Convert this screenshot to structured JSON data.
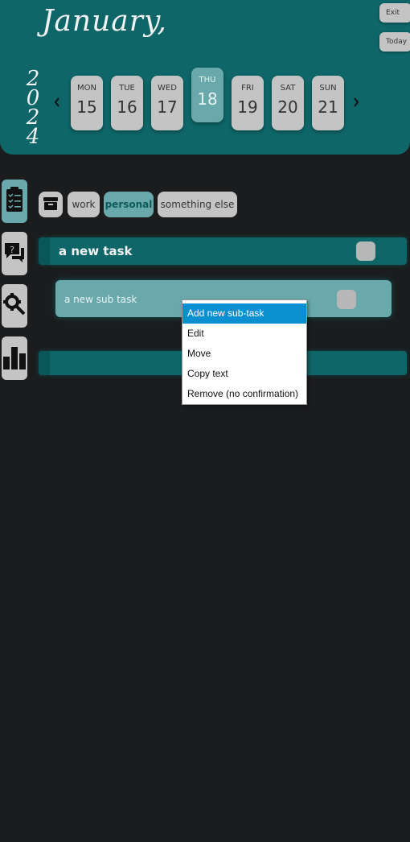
{
  "header": {
    "month": "January,",
    "year_digits": [
      "2",
      "0",
      "2",
      "4"
    ],
    "exit_label": "Exit",
    "today_label": "Today",
    "prev_arrow": "‹",
    "next_arrow": "›"
  },
  "week": [
    {
      "name": "MON",
      "num": "15",
      "selected": false
    },
    {
      "name": "TUE",
      "num": "16",
      "selected": false
    },
    {
      "name": "WED",
      "num": "17",
      "selected": false
    },
    {
      "name": "THU",
      "num": "18",
      "selected": true
    },
    {
      "name": "FRI",
      "num": "19",
      "selected": false
    },
    {
      "name": "SAT",
      "num": "20",
      "selected": false
    },
    {
      "name": "SUN",
      "num": "21",
      "selected": false
    }
  ],
  "sidebar": [
    {
      "icon": "checklist-icon",
      "selected": true
    },
    {
      "icon": "help-chat-icon",
      "selected": false
    },
    {
      "icon": "settings-wrench-icon",
      "selected": false
    },
    {
      "icon": "bar-chart-icon",
      "selected": false
    }
  ],
  "tabs": {
    "archive_icon": "archive-icon",
    "items": [
      {
        "label": "work",
        "selected": false
      },
      {
        "label": "personal",
        "selected": true
      },
      {
        "label": "something else",
        "selected": false
      }
    ]
  },
  "tasks": {
    "task_title": "a new task",
    "subtask_title": "a new sub task"
  },
  "context_menu": {
    "items": [
      "Add new sub-task",
      "Edit",
      "Move",
      "Copy text",
      "Remove (no confirmation)"
    ],
    "highlighted_index": 0
  },
  "colors": {
    "header_bg": "#0e6668",
    "accent": "#6aa9ab",
    "button_grey": "#c4c4c4",
    "menu_highlight": "#0a8fd0",
    "background": "#1b1c1e"
  }
}
